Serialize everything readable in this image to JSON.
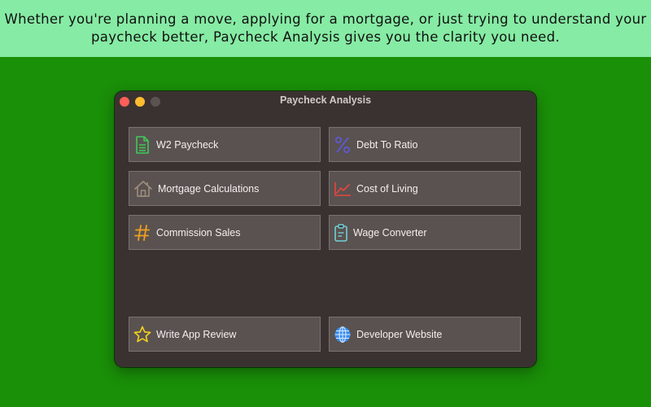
{
  "banner": {
    "text": "Whether you're planning a move, applying for a mortgage, or just trying to understand your paycheck better, Paycheck Analysis gives you the clarity you need."
  },
  "window": {
    "title": "Paycheck Analysis"
  },
  "buttons": [
    {
      "label": "W2 Paycheck",
      "icon": "document-icon",
      "color": "#3ec95a"
    },
    {
      "label": "Debt To Ratio",
      "icon": "percent-icon",
      "color": "#5b5bdc"
    },
    {
      "label": "Mortgage Calculations",
      "icon": "house-icon",
      "color": "#a08f80"
    },
    {
      "label": "Cost of Living",
      "icon": "line-chart-icon",
      "color": "#e8453c"
    },
    {
      "label": "Commission Sales",
      "icon": "hashtag-icon",
      "color": "#f0a020"
    },
    {
      "label": "Wage Converter",
      "icon": "clipboard-icon",
      "color": "#6fd1d6"
    },
    {
      "label": "Write App Review",
      "icon": "star-icon",
      "color": "#f6d21c"
    },
    {
      "label": "Developer Website",
      "icon": "globe-icon",
      "color": "#3b8df0"
    }
  ],
  "colors": {
    "background": "#1a8f08",
    "banner": "#86eba4",
    "window": "#3a3231",
    "button": "#5a5250",
    "traffic_close": "#fe5f57",
    "traffic_minimize": "#febc2e"
  }
}
